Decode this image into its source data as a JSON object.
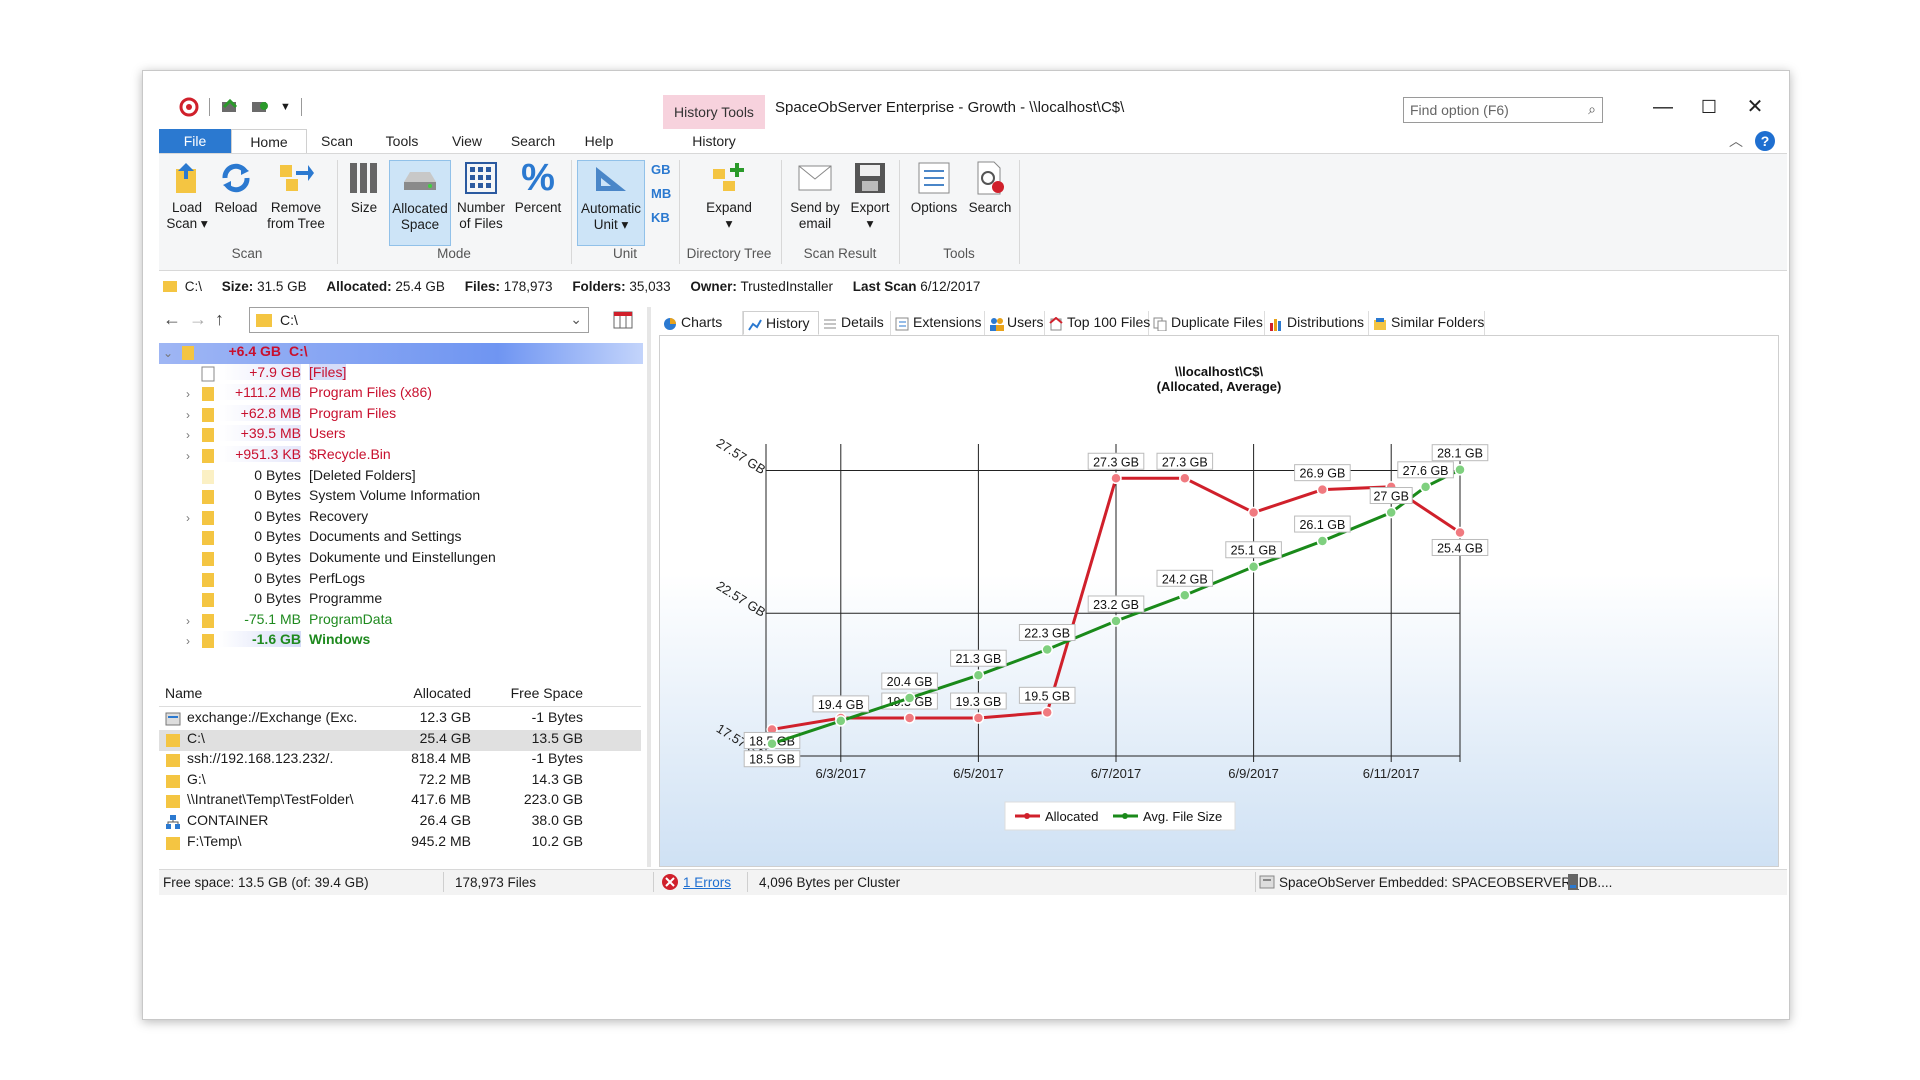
{
  "title": {
    "context_tab": "History Tools",
    "window_title": "SpaceObServer Enterprise - Growth - \\\\localhost\\C$\\",
    "find_placeholder": "Find option (F6)",
    "minimize": "—",
    "maximize": "☐",
    "close": "✕"
  },
  "ribbon_tabs": [
    "File",
    "Home",
    "Scan",
    "Tools",
    "View",
    "Search",
    "Help",
    "History"
  ],
  "ribbon": {
    "scan": {
      "load_scan": "Load",
      "load_scan2": "Scan ▾",
      "reload": "Reload",
      "remove": "Remove",
      "remove2": "from Tree",
      "label": "Scan"
    },
    "mode": {
      "size": "Size",
      "allocated": "Allocated",
      "allocated2": "Space",
      "number": "Number",
      "number2": "of Files",
      "percent": "Percent",
      "label": "Mode"
    },
    "unit": {
      "automatic": "Automatic",
      "automatic2": "Unit ▾",
      "gb": "GB",
      "mb": "MB",
      "kb": "KB",
      "label": "Unit"
    },
    "directory_tree": {
      "expand": "Expand",
      "expand2": "▾",
      "label": "Directory Tree"
    },
    "scan_result": {
      "send": "Send by",
      "send2": "email",
      "export": "Export",
      "export2": "▾",
      "label": "Scan Result"
    },
    "tools": {
      "options": "Options",
      "search": "Search",
      "label": "Tools"
    }
  },
  "info": {
    "path": "C:\\",
    "size_label": "Size:",
    "size_value": "31.5 GB",
    "allocated_label": "Allocated:",
    "allocated_value": "25.4 GB",
    "files_label": "Files:",
    "files_value": "178,973",
    "folders_label": "Folders:",
    "folders_value": "35,033",
    "owner_label": "Owner:",
    "owner_value": "TrustedInstaller",
    "lastscan_label": "Last Scan",
    "lastscan_value": "6/12/2017"
  },
  "nav": {
    "path": "C:\\"
  },
  "tree": [
    {
      "size": "+6.4 GB",
      "name": "C:\\",
      "color": "red",
      "bold": true
    },
    {
      "size": "+7.9 GB",
      "name": "[Files]",
      "color": "red",
      "bold": false
    },
    {
      "size": "+111.2 MB",
      "name": "Program Files (x86)",
      "color": "red",
      "bold": false
    },
    {
      "size": "+62.8 MB",
      "name": "Program Files",
      "color": "red",
      "bold": false
    },
    {
      "size": "+39.5 MB",
      "name": "Users",
      "color": "red",
      "bold": false
    },
    {
      "size": "+951.3 KB",
      "name": "$Recycle.Bin",
      "color": "red",
      "bold": false
    },
    {
      "size": "0 Bytes",
      "name": "[Deleted Folders]",
      "color": "none",
      "bold": false
    },
    {
      "size": "0 Bytes",
      "name": "System Volume Information",
      "color": "none",
      "bold": false
    },
    {
      "size": "0 Bytes",
      "name": "Recovery",
      "color": "none",
      "bold": false
    },
    {
      "size": "0 Bytes",
      "name": "Documents and Settings",
      "color": "none",
      "bold": false
    },
    {
      "size": "0 Bytes",
      "name": "Dokumente und Einstellungen",
      "color": "none",
      "bold": false
    },
    {
      "size": "0 Bytes",
      "name": "PerfLogs",
      "color": "none",
      "bold": false
    },
    {
      "size": "0 Bytes",
      "name": "Programme",
      "color": "none",
      "bold": false
    },
    {
      "size": "-75.1 MB",
      "name": "ProgramData",
      "color": "green",
      "bold": false
    },
    {
      "size": "-1.6 GB",
      "name": "Windows",
      "color": "green",
      "bold": true
    }
  ],
  "file_table": {
    "headers": [
      "Name",
      "Allocated",
      "Free Space"
    ],
    "rows": [
      {
        "name": "exchange://Exchange (Exc...",
        "allocated": "12.3 GB",
        "free": "-1 Bytes"
      },
      {
        "name": "C:\\",
        "allocated": "25.4 GB",
        "free": "13.5 GB"
      },
      {
        "name": "ssh://192.168.123.232/.",
        "allocated": "818.4 MB",
        "free": "-1 Bytes"
      },
      {
        "name": "G:\\",
        "allocated": "72.2 MB",
        "free": "14.3 GB"
      },
      {
        "name": "\\\\Intranet\\Temp\\TestFolder\\",
        "allocated": "417.6 MB",
        "free": "223.0 GB"
      },
      {
        "name": "CONTAINER",
        "allocated": "26.4 GB",
        "free": "38.0 GB"
      },
      {
        "name": "F:\\Temp\\",
        "allocated": "945.2 MB",
        "free": "10.2 GB"
      }
    ]
  },
  "view_tabs": [
    "Charts",
    "History",
    "Details",
    "Extensions",
    "Users",
    "Top 100 Files",
    "Duplicate Files",
    "Distributions",
    "Similar Folders"
  ],
  "chart_data": {
    "type": "line",
    "title": "\\\\localhost\\C$\\",
    "subtitle": "(Allocated, Average)",
    "y_ticks": [
      "27.57 GB",
      "22.57 GB",
      "17.57 GB"
    ],
    "x_ticks": [
      "6/3/2017",
      "6/5/2017",
      "6/7/2017",
      "6/9/2017",
      "6/11/2017"
    ],
    "legend": [
      "Allocated",
      "Avg. File Size"
    ],
    "ylim": [
      17.57,
      28.5
    ],
    "series": [
      {
        "name": "Allocated",
        "color": "#d0202b",
        "x": [
          "6/2/2017",
          "6/3/2017",
          "6/4/2017",
          "6/5/2017",
          "6/6/2017",
          "6/7/2017",
          "6/8/2017",
          "6/9/2017",
          "6/10/2017",
          "6/11/2017",
          "6/12/2017"
        ],
        "y": [
          18.5,
          18.9,
          18.9,
          18.9,
          19.1,
          27.3,
          27.3,
          26.1,
          26.9,
          27.0,
          25.4
        ],
        "labels": [
          "18.5 GB",
          "",
          "19.3 GB",
          "19.3 GB",
          "19.5 GB",
          "27.3 GB",
          "27.3 GB",
          "",
          "26.9 GB",
          "",
          "25.4 GB"
        ]
      },
      {
        "name": "Avg. File Size",
        "color": "#1a8a1a",
        "x": [
          "6/2/2017",
          "6/3/2017",
          "6/4/2017",
          "6/5/2017",
          "6/6/2017",
          "6/7/2017",
          "6/8/2017",
          "6/9/2017",
          "6/10/2017",
          "6/11/2017",
          "6/11/2017 12:00",
          "6/12/2017"
        ],
        "y": [
          18.0,
          18.8,
          19.6,
          20.4,
          21.3,
          22.3,
          23.2,
          24.2,
          25.1,
          26.1,
          27.0,
          27.6
        ],
        "labels": [
          "18.5 GB",
          "19.4 GB",
          "20.4 GB",
          "21.3 GB",
          "22.3 GB",
          "23.2 GB",
          "24.2 GB",
          "25.1 GB",
          "26.1 GB",
          "27 GB",
          "27.6 GB",
          "28.1 GB"
        ]
      }
    ]
  },
  "status": {
    "free_space": "Free space: 13.5 GB (of: 39.4 GB)",
    "files": "178,973 Files",
    "errors": "1 Errors",
    "cluster": "4,096 Bytes per Cluster",
    "db": "SpaceObServer Embedded: SPACEOBSERVER_DB...."
  },
  "colors": {
    "accent": "#2b79d0",
    "context_tab": "#f7d2dd",
    "increase": "#c8102e",
    "decrease": "#1f8a1f"
  }
}
